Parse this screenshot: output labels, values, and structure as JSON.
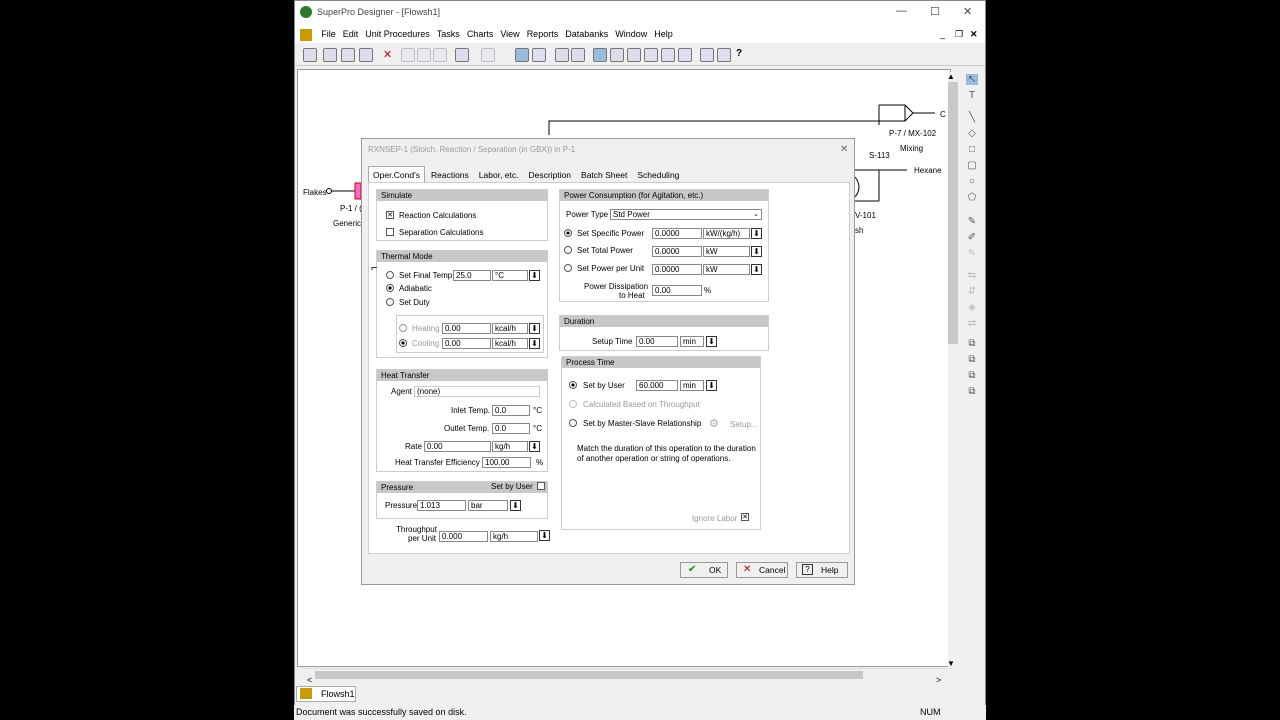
{
  "window": {
    "title": "SuperPro Designer - [Flowsh1]",
    "min": "—",
    "max": "☐",
    "close": "✕"
  },
  "menu": [
    "File",
    "Edit",
    "Unit Procedures",
    "Tasks",
    "Charts",
    "View",
    "Reports",
    "Databanks",
    "Window",
    "Help"
  ],
  "canvas_labels": {
    "flakes": "Flakes",
    "p1": "P-1 / (",
    "generic": "Generic",
    "p7": "P-7 / MX-102",
    "mixing": "Mixing",
    "s113": "S-113",
    "hexane": "Hexane",
    "v101": "V-101",
    "sh": "sh",
    "c": "C"
  },
  "doc_tab": "Flowsh1",
  "status": {
    "message": "Document was successfully saved on disk.",
    "num": "NUM"
  },
  "dialog": {
    "title": "RXNSEP-1 (Stoich. Reaction / Separation (in GBX)) in P-1",
    "tabs": [
      "Oper.Cond's",
      "Reactions",
      "Labor, etc.",
      "Description",
      "Batch Sheet",
      "Scheduling"
    ],
    "simulate": {
      "header": "Simulate",
      "reaction": "Reaction Calculations",
      "separation": "Separation Calculations"
    },
    "thermal": {
      "header": "Thermal Mode",
      "final_temp": "Set Final Temp",
      "final_temp_value": "25.0",
      "final_temp_unit": "°C",
      "adiabatic": "Adiabatic",
      "duty": "Set Duty",
      "heating": "Heating",
      "heating_value": "0.00",
      "heating_unit": "kcal/h",
      "cooling": "Cooling",
      "cooling_value": "0.00",
      "cooling_unit": "kcal/h"
    },
    "heat": {
      "header": "Heat Transfer",
      "agent_label": "Agent",
      "agent_value": "(none)",
      "inlet_label": "Inlet Temp.",
      "inlet_value": "0.0",
      "inlet_unit": "°C",
      "outlet_label": "Outlet Temp.",
      "outlet_value": "0.0",
      "outlet_unit": "°C",
      "rate_label": "Rate",
      "rate_value": "0.00",
      "rate_unit": "kg/h",
      "eff_label": "Heat Transfer Efficiency",
      "eff_value": "100.00",
      "eff_unit": "%"
    },
    "pressure": {
      "header": "Pressure",
      "set_by_user": "Set by User",
      "label": "Pressure",
      "value": "1.013",
      "unit": "bar"
    },
    "throughput": {
      "label1": "Throughput",
      "label2": "per Unit",
      "value": "0.000",
      "unit": "kg/h"
    },
    "power": {
      "header": "Power Consumption (for Agitation, etc.)",
      "type_label": "Power Type",
      "type_value": "Std Power",
      "specific": "Set Specific Power",
      "specific_value": "0.0000",
      "specific_unit": "kW/(kg/h)",
      "total": "Set Total Power",
      "total_value": "0.0000",
      "total_unit": "kW",
      "per_unit": "Set Power per Unit",
      "per_unit_value": "0.0000",
      "per_unit_unit": "kW",
      "diss1": "Power Dissipation",
      "diss2": "to Heat",
      "diss_value": "0.00",
      "diss_unit": "%"
    },
    "duration": {
      "header": "Duration",
      "setup_label": "Setup Time",
      "setup_value": "0.00",
      "setup_unit": "min"
    },
    "process": {
      "header": "Process Time",
      "by_user": "Set by User",
      "by_user_value": "60.000",
      "by_user_unit": "min",
      "throughput": "Calculated Based on Throughput",
      "master": "Set by Master-Slave Relationship",
      "setup": "Setup...",
      "note": "Match the duration of this operation to the duration of another operation or string of operations.",
      "ignore": "Ignore Labor"
    },
    "buttons": {
      "ok": "OK",
      "cancel": "Cancel",
      "help": "Help"
    }
  }
}
